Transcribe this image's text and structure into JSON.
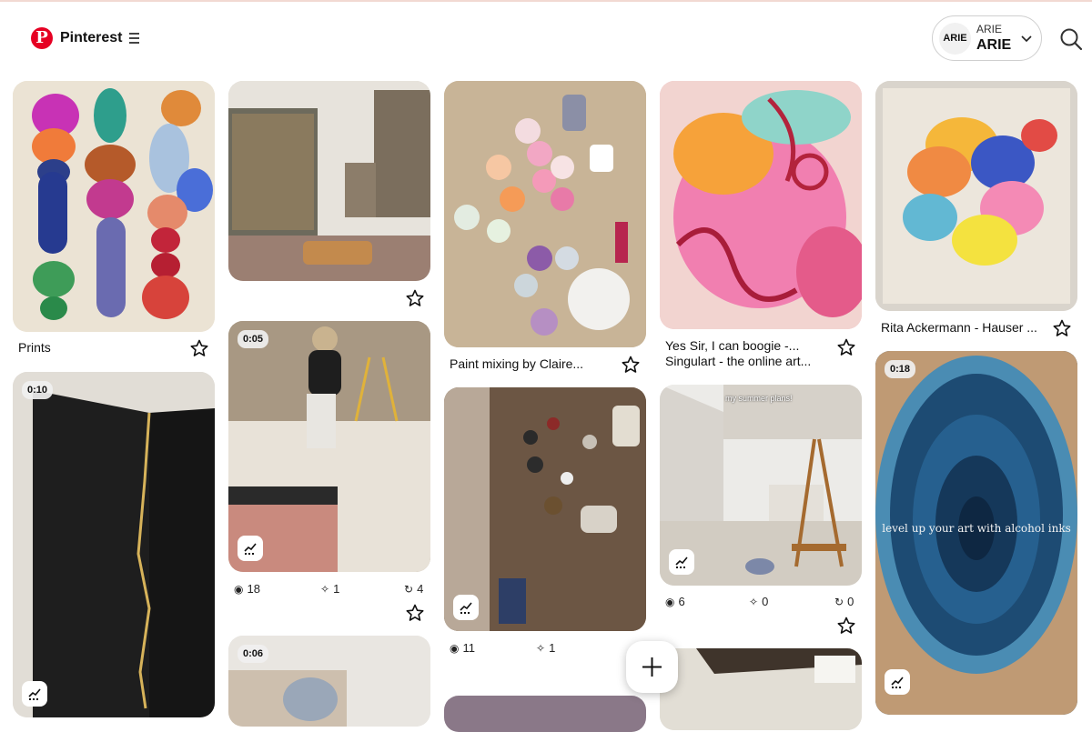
{
  "header": {
    "logo_letter": "P",
    "brand": "Pinterest",
    "account_badge": "ARIE",
    "account_small": "ARIE",
    "account_big": "ARIE"
  },
  "pins": {
    "prints": {
      "title": "Prints"
    },
    "studio_room": {},
    "paint_mixing": {
      "title": "Paint mixing by Claire..."
    },
    "yes_sir": {
      "title_line1": "Yes Sir, I can boogie -...",
      "title_line2": "Singulart - the online art..."
    },
    "rita": {
      "title": "Rita Ackermann - Hauser ..."
    },
    "black_gold": {
      "duration": "0:10"
    },
    "artist_floor": {
      "duration": "0:05",
      "views": "18",
      "saves": "1",
      "reposts": "4"
    },
    "paint_table": {
      "views": "11",
      "saves": "1"
    },
    "easel_room": {
      "overlay_text": "my summer plans!",
      "views": "6",
      "saves": "0",
      "reposts": "0"
    },
    "alcohol_inks": {
      "duration": "0:18",
      "overlay_text": "level up your art with alcohol inks"
    },
    "bottom_col2": {
      "duration": "0:06"
    }
  },
  "icons": {
    "star": "star-icon",
    "views": "eye-icon",
    "saves": "pin-icon",
    "reposts": "repost-icon",
    "stats": "analytics-icon",
    "create": "plus-icon"
  },
  "colors": {
    "brand": "#e60023"
  }
}
